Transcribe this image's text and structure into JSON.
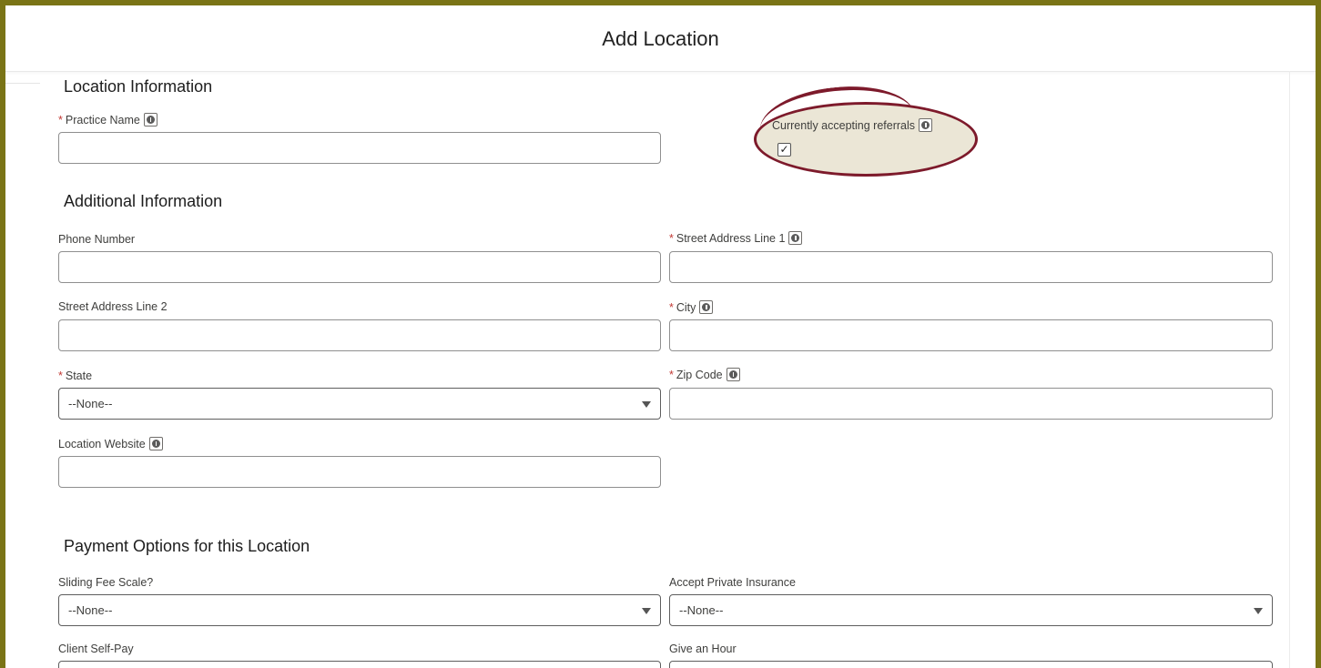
{
  "modal": {
    "title": "Add Location"
  },
  "sections": {
    "location_info": "Location Information",
    "additional_info": "Additional Information",
    "payment_options": "Payment Options for this Location"
  },
  "fields": {
    "practice_name": {
      "label": "Practice Name",
      "required": true,
      "value": ""
    },
    "accepting_referrals": {
      "label": "Currently accepting referrals",
      "checked": true,
      "check_glyph": "✓"
    },
    "phone_number": {
      "label": "Phone Number",
      "value": ""
    },
    "street1": {
      "label": "Street Address Line 1",
      "required": true,
      "value": ""
    },
    "street2": {
      "label": "Street Address Line 2",
      "value": ""
    },
    "city": {
      "label": "City",
      "required": true,
      "value": ""
    },
    "state": {
      "label": "State",
      "required": true,
      "value": "--None--"
    },
    "zip": {
      "label": "Zip Code",
      "required": true,
      "value": ""
    },
    "website": {
      "label": "Location Website",
      "value": ""
    },
    "sliding_fee": {
      "label": "Sliding Fee Scale?",
      "value": "--None--"
    },
    "private_insurance": {
      "label": "Accept Private Insurance",
      "value": "--None--"
    },
    "self_pay": {
      "label": "Client Self-Pay",
      "value": ""
    },
    "give_an_hour": {
      "label": "Give an Hour",
      "value": ""
    }
  },
  "required_marker": "*",
  "icons": {
    "info": "info-icon",
    "dropdown": "chevron-down-icon"
  },
  "colors": {
    "frame": "#7a7416",
    "highlight_stroke": "#7d1a2b",
    "highlight_fill": "#ebe6d6",
    "required": "#c23934"
  }
}
